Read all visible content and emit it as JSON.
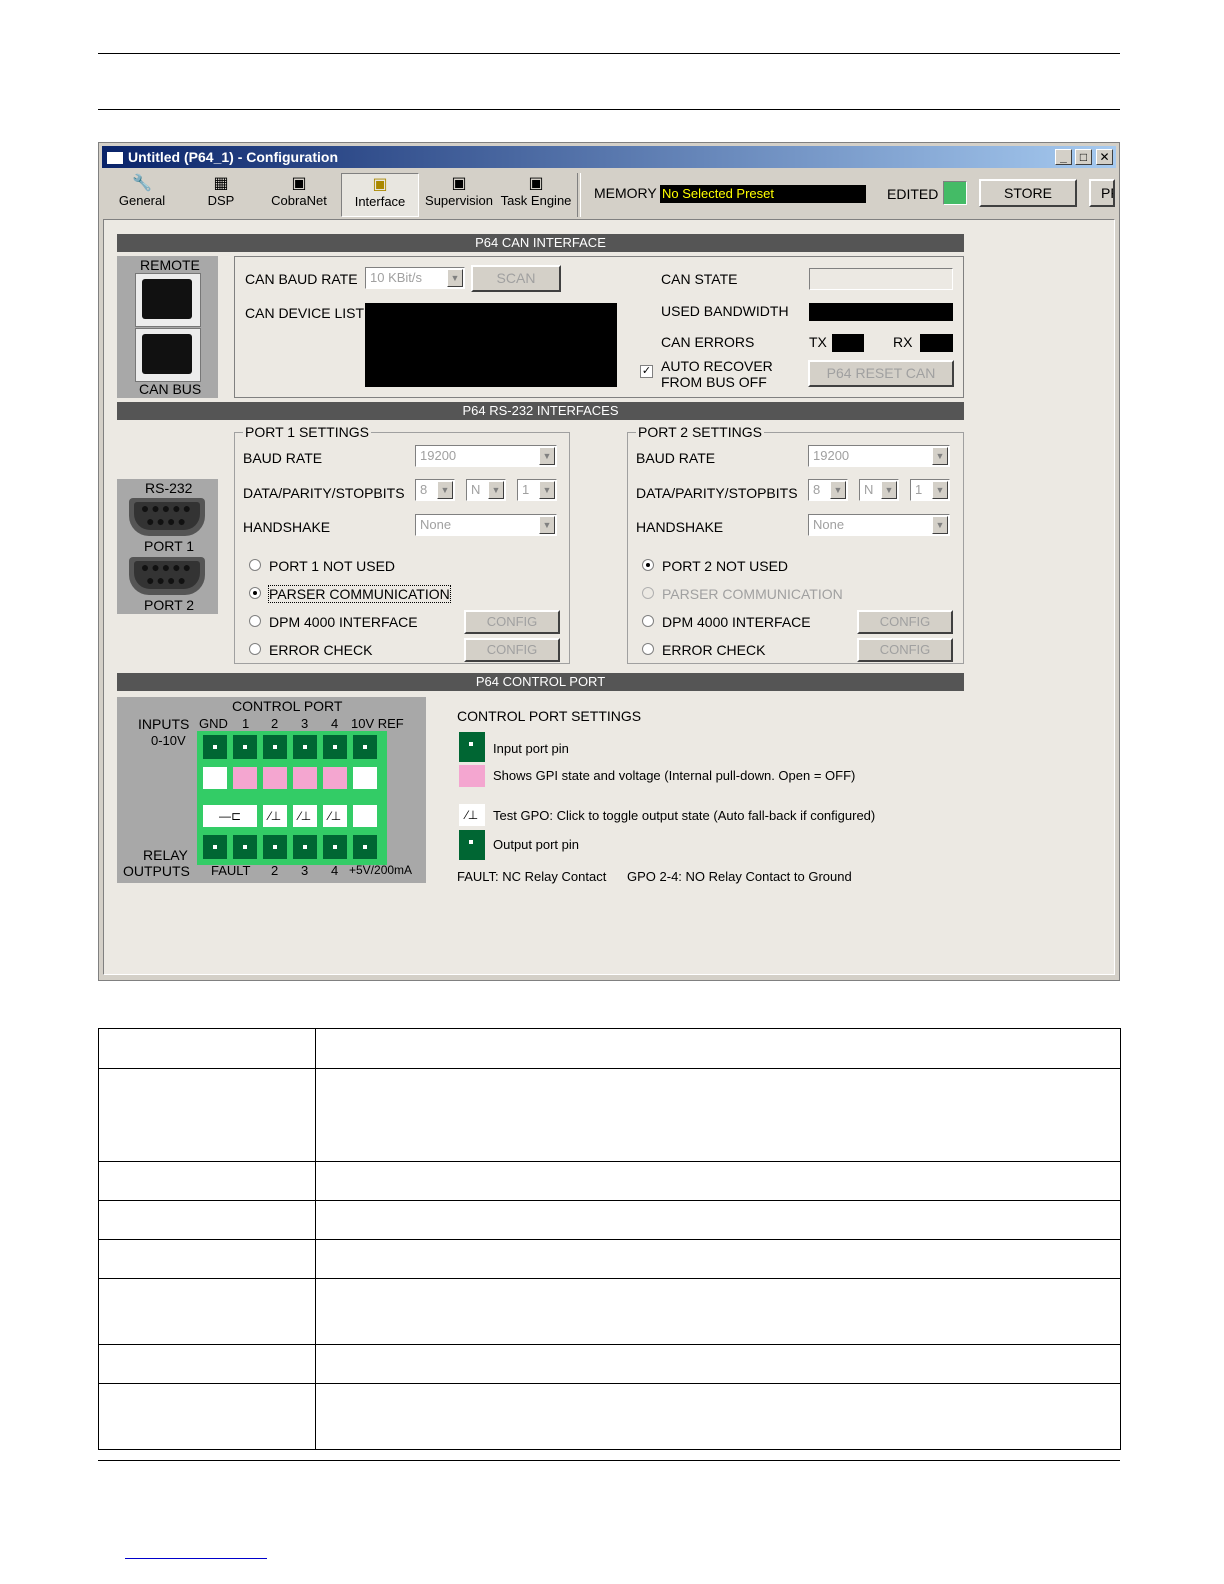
{
  "window": {
    "title": "Untitled (P64_1) - Configuration",
    "controls": [
      "_",
      "□",
      "✕"
    ]
  },
  "toolbar": {
    "tabs": [
      {
        "label": "General",
        "icon": "wrench-icon"
      },
      {
        "label": "DSP",
        "icon": "dsp-icon"
      },
      {
        "label": "CobraNet",
        "icon": "network-icon"
      },
      {
        "label": "Interface",
        "icon": "interface-icon"
      },
      {
        "label": "Supervision",
        "icon": "supervision-icon"
      },
      {
        "label": "Task Engine",
        "icon": "task-engine-icon"
      }
    ],
    "memory_label": "MEMORY",
    "memory_value": "No Selected Preset",
    "edited_label": "EDITED",
    "store_label": "STORE",
    "pf_label": "PF"
  },
  "can": {
    "section_title": "P64 CAN INTERFACE",
    "remote_label": "REMOTE",
    "canbus_label": "CAN BUS",
    "baud_label": "CAN BAUD RATE",
    "baud_value": "10 KBit/s",
    "scan_label": "SCAN",
    "device_list_label": "CAN DEVICE LIST",
    "state_label": "CAN STATE",
    "bandwidth_label": "USED BANDWIDTH",
    "errors_label": "CAN ERRORS",
    "tx_label": "TX",
    "rx_label": "RX",
    "auto_recover_line1": "AUTO RECOVER",
    "auto_recover_line2": "FROM BUS OFF",
    "auto_recover_checked": true,
    "reset_label": "P64 RESET CAN"
  },
  "rs232": {
    "section_title": "P64 RS-232 INTERFACES",
    "connector_label": "RS-232",
    "port1_label": "PORT 1",
    "port2_label": "PORT 2",
    "baud_label": "BAUD RATE",
    "dps_label": "DATA/PARITY/STOPBITS",
    "handshake_label": "HANDSHAKE",
    "config_label": "CONFIG",
    "port1": {
      "title": "PORT 1 SETTINGS",
      "baud": "19200",
      "data": "8",
      "parity": "N",
      "stop": "1",
      "handshake": "None",
      "opt_not_used": "PORT 1 NOT USED",
      "opt_parser": "PARSER COMMUNICATION",
      "opt_dpm": "DPM 4000 INTERFACE",
      "opt_error": "ERROR CHECK"
    },
    "port2": {
      "title": "PORT 2 SETTINGS",
      "baud": "19200",
      "data": "8",
      "parity": "N",
      "stop": "1",
      "handshake": "None",
      "opt_not_used": "PORT 2 NOT USED",
      "opt_parser": "PARSER COMMUNICATION",
      "opt_dpm": "DPM 4000 INTERFACE",
      "opt_error": "ERROR CHECK"
    }
  },
  "control": {
    "section_title": "P64 CONTROL PORT",
    "title": "CONTROL PORT",
    "inputs_label": "INPUTS",
    "inputs_range": "0-10V",
    "relay_label": "RELAY",
    "outputs_label": "OUTPUTS",
    "top_headers": [
      "GND",
      "1",
      "2",
      "3",
      "4",
      "10V REF"
    ],
    "bottom_headers": [
      "FAULT",
      "2",
      "3",
      "4",
      "+5V/200mA"
    ],
    "settings_title": "CONTROL PORT SETTINGS",
    "legend_input": "Input port pin",
    "legend_gpi": "Shows GPI state and voltage (Internal pull-down. Open = OFF)",
    "legend_gpo": "Test GPO: Click to toggle output state (Auto fall-back if configured)",
    "legend_output": "Output port pin",
    "fault_note": "FAULT: NC Relay Contact",
    "gpo_note": "GPO 2-4: NO Relay Contact to Ground"
  },
  "colors": {
    "pin_green": "#006633",
    "connector_green": "#33cc66",
    "gpi_pink": "#f4a6d0",
    "edited_led": "#44bb66",
    "memory_text": "#ffff00"
  }
}
